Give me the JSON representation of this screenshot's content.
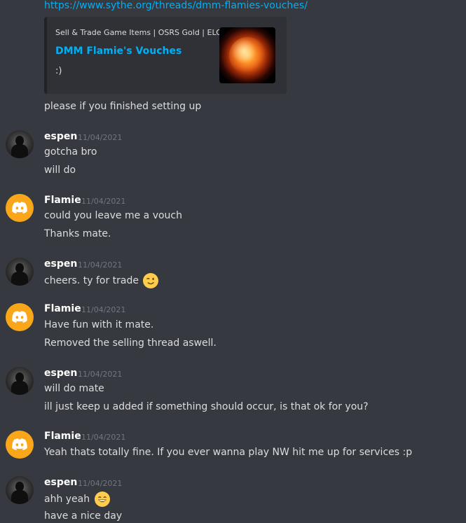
{
  "link": {
    "url_text": "https://www.sythe.org/threads/dmm-flamies-vouches/"
  },
  "embed": {
    "provider": "Sell & Trade Game Items | OSRS Gold | ELO",
    "title": "DMM Flamie's Vouches",
    "description": ":)"
  },
  "first_reply": "please if you finished setting up",
  "messages": [
    {
      "author": "espen",
      "timestamp": "11/04/2021",
      "avatar": "dark-photo-avatar",
      "lines": [
        "gotcha bro",
        "will do"
      ]
    },
    {
      "author": "Flamie",
      "timestamp": "11/04/2021",
      "avatar": "discord-logo-avatar",
      "lines": [
        "could you leave me a vouch",
        "Thanks mate."
      ]
    },
    {
      "author": "espen",
      "timestamp": "11/04/2021",
      "avatar": "dark-photo-avatar",
      "lines": [
        "cheers. ty for trade"
      ],
      "emoji": "winking-face-emoji"
    },
    {
      "author": "Flamie",
      "timestamp": "11/04/2021",
      "avatar": "discord-logo-avatar",
      "lines": [
        "Have fun with it mate.",
        "Removed the selling thread aswell."
      ]
    },
    {
      "author": "espen",
      "timestamp": "11/04/2021",
      "avatar": "dark-photo-avatar",
      "lines": [
        "will do mate",
        "ill just keep u added if something should occur, is that ok for you?"
      ]
    },
    {
      "author": "Flamie",
      "timestamp": "11/04/2021",
      "avatar": "discord-logo-avatar",
      "lines": [
        "Yeah thats totally fine. If you ever wanna play NW hit me up for services :p"
      ]
    },
    {
      "author": "espen",
      "timestamp": "11/04/2021",
      "avatar": "dark-photo-avatar",
      "lines": [
        "ahh yeah",
        "have a nice day"
      ],
      "emoji": "grinning-face-emoji"
    }
  ],
  "colors": {
    "background": "#36393f",
    "link": "#00b0f4",
    "flamie_avatar": "#faa61a",
    "timestamp": "#72767d",
    "embed_bg": "#2f3136"
  }
}
